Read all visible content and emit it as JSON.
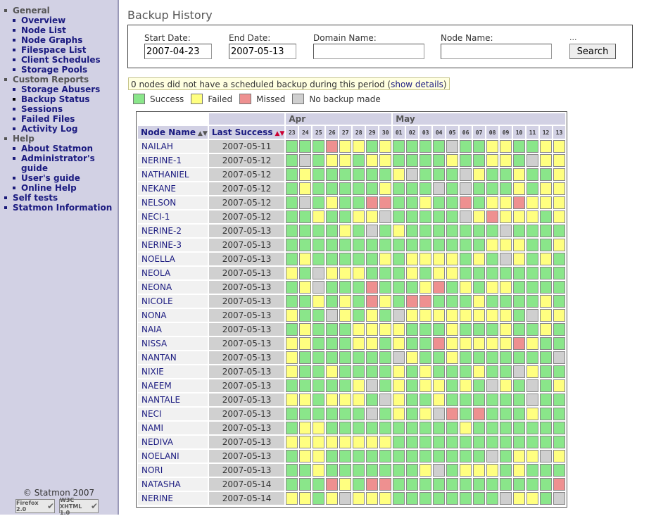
{
  "sidebar": {
    "items": [
      {
        "type": "sec",
        "label": "General"
      },
      {
        "type": "sub",
        "label": "Overview"
      },
      {
        "type": "sub",
        "label": "Node List"
      },
      {
        "type": "sub",
        "label": "Node Graphs"
      },
      {
        "type": "sub",
        "label": "Filespace List"
      },
      {
        "type": "sub",
        "label": "Client Schedules"
      },
      {
        "type": "sub",
        "label": "Storage Pools"
      },
      {
        "type": "sec",
        "label": "Custom Reports"
      },
      {
        "type": "sub",
        "label": "Storage Abusers"
      },
      {
        "type": "sub",
        "label": "Backup Status",
        "active": true
      },
      {
        "type": "sub",
        "label": "Sessions"
      },
      {
        "type": "sub",
        "label": "Failed Files"
      },
      {
        "type": "sub",
        "label": "Activity Log"
      },
      {
        "type": "sec",
        "label": "Help"
      },
      {
        "type": "sub",
        "label": "About Statmon"
      },
      {
        "type": "sub",
        "label": "Administrator's guide"
      },
      {
        "type": "sub",
        "label": "User's guide"
      },
      {
        "type": "sub",
        "label": "Online Help"
      },
      {
        "type": "top",
        "label": "Self tests"
      },
      {
        "type": "top",
        "label": "Statmon Information"
      }
    ],
    "copyright": "© Statmon 2007",
    "badges": [
      {
        "label": "Firefox 2.0",
        "icon": "firefox-badge-icon"
      },
      {
        "label": "W3C XHTML 1.0",
        "icon": "w3c-badge-icon"
      }
    ]
  },
  "page": {
    "title": "Backup History"
  },
  "search": {
    "start_label": "Start Date:",
    "start_value": "2007-04-23",
    "end_label": "End Date:",
    "end_value": "2007-05-13",
    "domain_label": "Domain Name:",
    "domain_value": "",
    "node_label": "Node Name:",
    "node_value": "",
    "ellipsis": "...",
    "button": "Search"
  },
  "notice": {
    "text": "0 nodes did not have a scheduled backup during this period (",
    "link": "show details",
    "suffix": ")"
  },
  "legend": [
    {
      "code": "S",
      "label": "Success",
      "color": "#8ae68a"
    },
    {
      "code": "F",
      "label": "Failed",
      "color": "#ffff80"
    },
    {
      "code": "M",
      "label": "Missed",
      "color": "#ee9090"
    },
    {
      "code": "N",
      "label": "No backup made",
      "color": "#cfcfcf"
    }
  ],
  "table": {
    "col_node": "Node Name",
    "col_last": "Last Success",
    "months": [
      {
        "name": "Apr",
        "span": 8
      },
      {
        "name": "May",
        "span": 13
      }
    ],
    "days": [
      "23",
      "24",
      "25",
      "26",
      "27",
      "28",
      "29",
      "30",
      "01",
      "02",
      "03",
      "04",
      "05",
      "06",
      "07",
      "08",
      "09",
      "10",
      "11",
      "12",
      "13"
    ],
    "rows": [
      {
        "node": "NAILAH",
        "last": "2007-05-11",
        "status": "SSSMFFSFSSSSNSSFFSSFF"
      },
      {
        "node": "NERINE-1",
        "last": "2007-05-12",
        "status": "SNSFFSFFSSSSFSSFFSNFF"
      },
      {
        "node": "NATHANIEL",
        "last": "2007-05-12",
        "status": "SFSSSSSSFNSSSNFSSFSSF"
      },
      {
        "node": "NEKANE",
        "last": "2007-05-12",
        "status": "SFSSSSSFSSSNSNSSSFSFF"
      },
      {
        "node": "NELSON",
        "last": "2007-05-12",
        "status": "SNSFSSMMSSFSSMSFFMFFF"
      },
      {
        "node": "NECI-1",
        "last": "2007-05-12",
        "status": "SSFSSFFNSSSSSNFMFFFSF"
      },
      {
        "node": "NERINE-2",
        "last": "2007-05-13",
        "status": "SSSSFSNSFSSSSSSSNSSSS"
      },
      {
        "node": "NERINE-3",
        "last": "2007-05-13",
        "status": "SSSSSSSSSSSSSSSFFFSSF"
      },
      {
        "node": "NOELLA",
        "last": "2007-05-13",
        "status": "SFSSSSSFSFFFFSFSNFSFS"
      },
      {
        "node": "NEOLA",
        "last": "2007-05-13",
        "status": "FSNFFFSSSFSFFSSSSSSSS"
      },
      {
        "node": "NEONA",
        "last": "2007-05-13",
        "status": "SFNSSSMSSSFMSFSFFSSSS"
      },
      {
        "node": "NICOLE",
        "last": "2007-05-13",
        "status": "SSFSFSMFSMMSSSFSSSSFS"
      },
      {
        "node": "NONA",
        "last": "2007-05-13",
        "status": "FSSNFSFSNFFFFFFFFSNFF"
      },
      {
        "node": "NAIA",
        "last": "2007-05-13",
        "status": "SFSSSFFFFSSSFSSSFSSFS"
      },
      {
        "node": "NISSA",
        "last": "2007-05-13",
        "status": "FFSSSFFSFSSMFFFFFMFSS"
      },
      {
        "node": "NANTAN",
        "last": "2007-05-13",
        "status": "FSSSSSSSNFSSFSSSSSSSN"
      },
      {
        "node": "NIXIE",
        "last": "2007-05-13",
        "status": "FSSFSSSSFSFSSSFSSNFSS"
      },
      {
        "node": "NAEEM",
        "last": "2007-05-13",
        "status": "SSSSSFNSFSFFSFSNFSNSF"
      },
      {
        "node": "NANTALE",
        "last": "2007-05-13",
        "status": "FFSFFFSNFSSFSSSSSSNSS"
      },
      {
        "node": "NECI",
        "last": "2007-05-13",
        "status": "SSSSSSNSFSFNMSMSSSFSS"
      },
      {
        "node": "NAMI",
        "last": "2007-05-13",
        "status": "SFFSSSSSSSSSSFSSSSSSS"
      },
      {
        "node": "NEDIVA",
        "last": "2007-05-13",
        "status": "FFFFFFFFSSSSSSSSSSSSS"
      },
      {
        "node": "NOELANI",
        "last": "2007-05-13",
        "status": "SFFSSSSSSSSSSSSNSFFNF"
      },
      {
        "node": "NORI",
        "last": "2007-05-13",
        "status": "SSFSSSSSSSFNSFFFSFSSS"
      },
      {
        "node": "NATASHA",
        "last": "2007-05-14",
        "status": "SSSMFSMMSSSSSSSSSSSSM"
      },
      {
        "node": "NERINE",
        "last": "2007-05-14",
        "status": "FFSFNFFFSSSSSSSSNFFSN"
      }
    ]
  }
}
